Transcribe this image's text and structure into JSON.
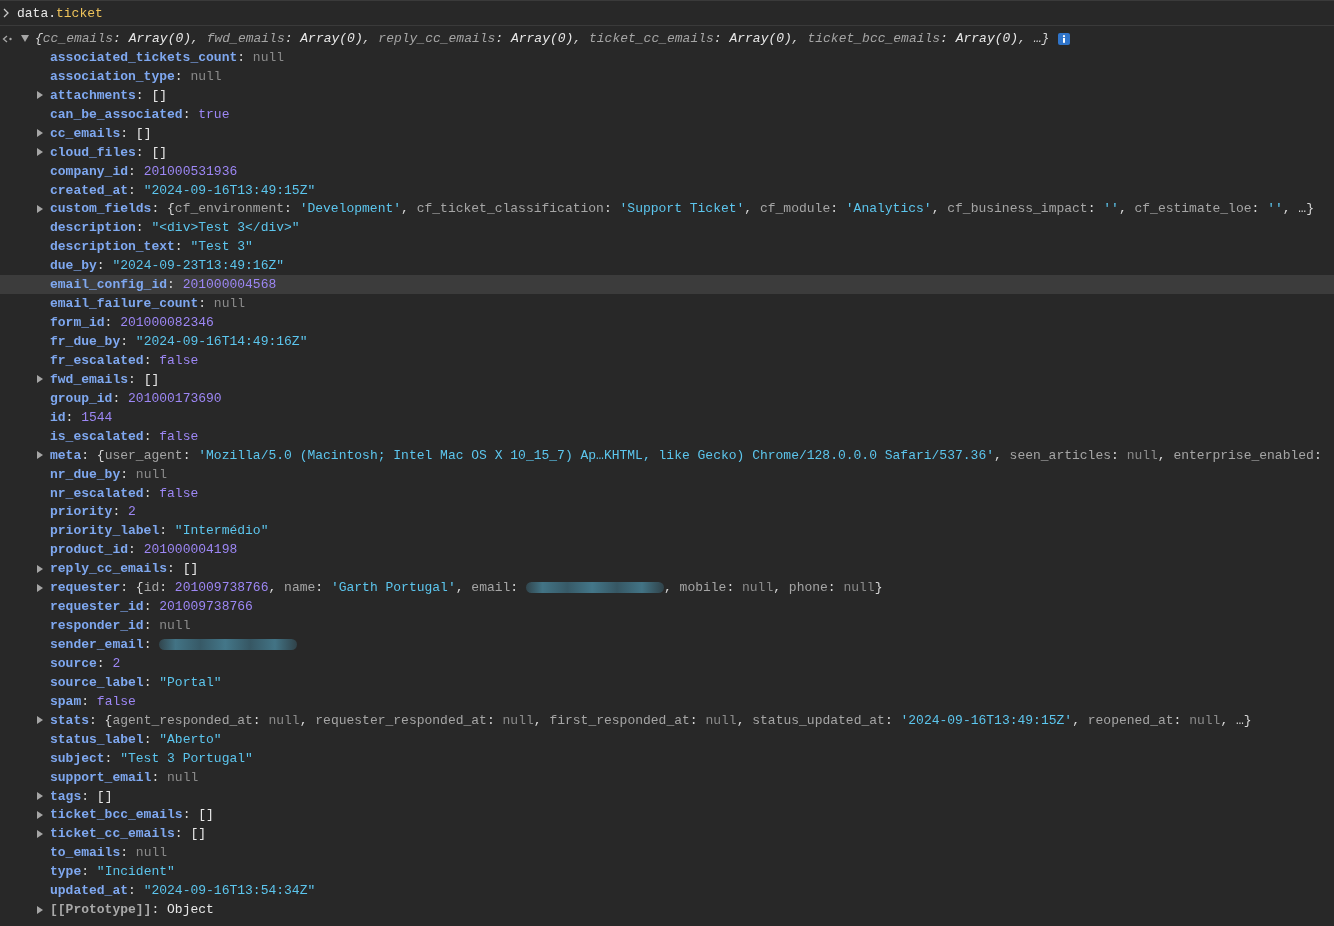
{
  "command": {
    "tokens": [
      {
        "kind": "ident",
        "text": "data."
      },
      {
        "kind": "property",
        "text": "ticket"
      }
    ]
  },
  "result": {
    "expanded": true,
    "tokens": [
      {
        "kind": "punct",
        "text": "{"
      },
      {
        "kind": "plain",
        "text": "cc_emails"
      },
      {
        "kind": "punct",
        "text": ": "
      },
      {
        "kind": "value",
        "text": "Array(0)"
      },
      {
        "kind": "punct",
        "text": ", "
      },
      {
        "kind": "plain",
        "text": "fwd_emails"
      },
      {
        "kind": "punct",
        "text": ": "
      },
      {
        "kind": "value",
        "text": "Array(0)"
      },
      {
        "kind": "punct",
        "text": ", "
      },
      {
        "kind": "plain",
        "text": "reply_cc_emails"
      },
      {
        "kind": "punct",
        "text": ": "
      },
      {
        "kind": "value",
        "text": "Array(0)"
      },
      {
        "kind": "punct",
        "text": ", "
      },
      {
        "kind": "plain",
        "text": "ticket_cc_emails"
      },
      {
        "kind": "punct",
        "text": ": "
      },
      {
        "kind": "value",
        "text": "Array(0)"
      },
      {
        "kind": "punct",
        "text": ", "
      },
      {
        "kind": "plain",
        "text": "ticket_bcc_emails"
      },
      {
        "kind": "punct",
        "text": ": "
      },
      {
        "kind": "value",
        "text": "Array(0)"
      },
      {
        "kind": "punct",
        "text": ", …}"
      }
    ]
  },
  "properties": [
    {
      "selected": false,
      "tokens": [
        {
          "kind": "key",
          "text": "associated_tickets_count"
        },
        {
          "kind": "punct",
          "text": ": "
        },
        {
          "kind": "null",
          "text": "null"
        }
      ]
    },
    {
      "selected": false,
      "tokens": [
        {
          "kind": "key",
          "text": "association_type"
        },
        {
          "kind": "punct",
          "text": ": "
        },
        {
          "kind": "null",
          "text": "null"
        }
      ]
    },
    {
      "expanded": false,
      "selected": false,
      "tokens": [
        {
          "kind": "key",
          "text": "attachments"
        },
        {
          "kind": "punct",
          "text": ": "
        },
        {
          "kind": "value",
          "text": "[]"
        }
      ]
    },
    {
      "selected": false,
      "tokens": [
        {
          "kind": "key",
          "text": "can_be_associated"
        },
        {
          "kind": "punct",
          "text": ": "
        },
        {
          "kind": "boolean",
          "text": "true"
        }
      ]
    },
    {
      "expanded": false,
      "selected": false,
      "tokens": [
        {
          "kind": "key",
          "text": "cc_emails"
        },
        {
          "kind": "punct",
          "text": ": "
        },
        {
          "kind": "value",
          "text": "[]"
        }
      ]
    },
    {
      "expanded": false,
      "selected": false,
      "tokens": [
        {
          "kind": "key",
          "text": "cloud_files"
        },
        {
          "kind": "punct",
          "text": ": "
        },
        {
          "kind": "value",
          "text": "[]"
        }
      ]
    },
    {
      "selected": false,
      "tokens": [
        {
          "kind": "key",
          "text": "company_id"
        },
        {
          "kind": "punct",
          "text": ": "
        },
        {
          "kind": "number",
          "text": "201000531936"
        }
      ]
    },
    {
      "selected": false,
      "tokens": [
        {
          "kind": "key",
          "text": "created_at"
        },
        {
          "kind": "punct",
          "text": ": "
        },
        {
          "kind": "string",
          "text": "\"2024-09-16T13:49:15Z\""
        }
      ]
    },
    {
      "expanded": false,
      "selected": false,
      "tokens": [
        {
          "kind": "key",
          "text": "custom_fields"
        },
        {
          "kind": "punct",
          "text": ": {"
        },
        {
          "kind": "plain",
          "text": "cf_environment"
        },
        {
          "kind": "punct",
          "text": ": "
        },
        {
          "kind": "string",
          "text": "'Development'"
        },
        {
          "kind": "punct",
          "text": ", "
        },
        {
          "kind": "plain",
          "text": "cf_ticket_classification"
        },
        {
          "kind": "punct",
          "text": ": "
        },
        {
          "kind": "string",
          "text": "'Support Ticket'"
        },
        {
          "kind": "punct",
          "text": ", "
        },
        {
          "kind": "plain",
          "text": "cf_module"
        },
        {
          "kind": "punct",
          "text": ": "
        },
        {
          "kind": "string",
          "text": "'Analytics'"
        },
        {
          "kind": "punct",
          "text": ", "
        },
        {
          "kind": "plain",
          "text": "cf_business_impact"
        },
        {
          "kind": "punct",
          "text": ": "
        },
        {
          "kind": "string",
          "text": "''"
        },
        {
          "kind": "punct",
          "text": ", "
        },
        {
          "kind": "plain",
          "text": "cf_estimate_loe"
        },
        {
          "kind": "punct",
          "text": ": "
        },
        {
          "kind": "string",
          "text": "''"
        },
        {
          "kind": "punct",
          "text": ", …}"
        }
      ]
    },
    {
      "selected": false,
      "tokens": [
        {
          "kind": "key",
          "text": "description"
        },
        {
          "kind": "punct",
          "text": ": "
        },
        {
          "kind": "string",
          "text": "\"<div>Test 3</div>\""
        }
      ]
    },
    {
      "selected": false,
      "tokens": [
        {
          "kind": "key",
          "text": "description_text"
        },
        {
          "kind": "punct",
          "text": ": "
        },
        {
          "kind": "string",
          "text": "\"Test 3\""
        }
      ]
    },
    {
      "selected": false,
      "tokens": [
        {
          "kind": "key",
          "text": "due_by"
        },
        {
          "kind": "punct",
          "text": ": "
        },
        {
          "kind": "string",
          "text": "\"2024-09-23T13:49:16Z\""
        }
      ]
    },
    {
      "selected": true,
      "tokens": [
        {
          "kind": "key",
          "text": "email_config_id"
        },
        {
          "kind": "punct",
          "text": ": "
        },
        {
          "kind": "number",
          "text": "201000004568"
        }
      ]
    },
    {
      "selected": false,
      "tokens": [
        {
          "kind": "key",
          "text": "email_failure_count"
        },
        {
          "kind": "punct",
          "text": ": "
        },
        {
          "kind": "null",
          "text": "null"
        }
      ]
    },
    {
      "selected": false,
      "tokens": [
        {
          "kind": "key",
          "text": "form_id"
        },
        {
          "kind": "punct",
          "text": ": "
        },
        {
          "kind": "number",
          "text": "201000082346"
        }
      ]
    },
    {
      "selected": false,
      "tokens": [
        {
          "kind": "key",
          "text": "fr_due_by"
        },
        {
          "kind": "punct",
          "text": ": "
        },
        {
          "kind": "string",
          "text": "\"2024-09-16T14:49:16Z\""
        }
      ]
    },
    {
      "selected": false,
      "tokens": [
        {
          "kind": "key",
          "text": "fr_escalated"
        },
        {
          "kind": "punct",
          "text": ": "
        },
        {
          "kind": "boolean",
          "text": "false"
        }
      ]
    },
    {
      "expanded": false,
      "selected": false,
      "tokens": [
        {
          "kind": "key",
          "text": "fwd_emails"
        },
        {
          "kind": "punct",
          "text": ": "
        },
        {
          "kind": "value",
          "text": "[]"
        }
      ]
    },
    {
      "selected": false,
      "tokens": [
        {
          "kind": "key",
          "text": "group_id"
        },
        {
          "kind": "punct",
          "text": ": "
        },
        {
          "kind": "number",
          "text": "201000173690"
        }
      ]
    },
    {
      "selected": false,
      "tokens": [
        {
          "kind": "key",
          "text": "id"
        },
        {
          "kind": "punct",
          "text": ": "
        },
        {
          "kind": "number",
          "text": "1544"
        }
      ]
    },
    {
      "selected": false,
      "tokens": [
        {
          "kind": "key",
          "text": "is_escalated"
        },
        {
          "kind": "punct",
          "text": ": "
        },
        {
          "kind": "boolean",
          "text": "false"
        }
      ]
    },
    {
      "expanded": false,
      "selected": false,
      "tokens": [
        {
          "kind": "key",
          "text": "meta"
        },
        {
          "kind": "punct",
          "text": ": {"
        },
        {
          "kind": "plain",
          "text": "user_agent"
        },
        {
          "kind": "punct",
          "text": ": "
        },
        {
          "kind": "string",
          "text": "'Mozilla/5.0 (Macintosh; Intel Mac OS X 10_15_7) Ap…KHTML, like Gecko) Chrome/128.0.0.0 Safari/537.36'"
        },
        {
          "kind": "punct",
          "text": ", "
        },
        {
          "kind": "plain",
          "text": "seen_articles"
        },
        {
          "kind": "punct",
          "text": ": "
        },
        {
          "kind": "null",
          "text": "null"
        },
        {
          "kind": "punct",
          "text": ", "
        },
        {
          "kind": "plain",
          "text": "enterprise_enabled"
        },
        {
          "kind": "punct",
          "text": ":"
        }
      ]
    },
    {
      "selected": false,
      "tokens": [
        {
          "kind": "key",
          "text": "nr_due_by"
        },
        {
          "kind": "punct",
          "text": ": "
        },
        {
          "kind": "null",
          "text": "null"
        }
      ]
    },
    {
      "selected": false,
      "tokens": [
        {
          "kind": "key",
          "text": "nr_escalated"
        },
        {
          "kind": "punct",
          "text": ": "
        },
        {
          "kind": "boolean",
          "text": "false"
        }
      ]
    },
    {
      "selected": false,
      "tokens": [
        {
          "kind": "key",
          "text": "priority"
        },
        {
          "kind": "punct",
          "text": ": "
        },
        {
          "kind": "number",
          "text": "2"
        }
      ]
    },
    {
      "selected": false,
      "tokens": [
        {
          "kind": "key",
          "text": "priority_label"
        },
        {
          "kind": "punct",
          "text": ": "
        },
        {
          "kind": "string",
          "text": "\"Intermédio\""
        }
      ]
    },
    {
      "selected": false,
      "tokens": [
        {
          "kind": "key",
          "text": "product_id"
        },
        {
          "kind": "punct",
          "text": ": "
        },
        {
          "kind": "number",
          "text": "201000004198"
        }
      ]
    },
    {
      "expanded": false,
      "selected": false,
      "tokens": [
        {
          "kind": "key",
          "text": "reply_cc_emails"
        },
        {
          "kind": "punct",
          "text": ": "
        },
        {
          "kind": "value",
          "text": "[]"
        }
      ]
    },
    {
      "expanded": false,
      "selected": false,
      "tokens": [
        {
          "kind": "key",
          "text": "requester"
        },
        {
          "kind": "punct",
          "text": ": {"
        },
        {
          "kind": "plain",
          "text": "id"
        },
        {
          "kind": "punct",
          "text": ": "
        },
        {
          "kind": "number",
          "text": "201009738766"
        },
        {
          "kind": "punct",
          "text": ", "
        },
        {
          "kind": "plain",
          "text": "name"
        },
        {
          "kind": "punct",
          "text": ": "
        },
        {
          "kind": "string",
          "text": "'Garth Portugal'"
        },
        {
          "kind": "punct",
          "text": ", "
        },
        {
          "kind": "plain",
          "text": "email"
        },
        {
          "kind": "punct",
          "text": ": "
        },
        {
          "kind": "redacted"
        },
        {
          "kind": "punct",
          "text": ", "
        },
        {
          "kind": "plain",
          "text": "mobile"
        },
        {
          "kind": "punct",
          "text": ": "
        },
        {
          "kind": "null",
          "text": "null"
        },
        {
          "kind": "punct",
          "text": ", "
        },
        {
          "kind": "plain",
          "text": "phone"
        },
        {
          "kind": "punct",
          "text": ": "
        },
        {
          "kind": "null",
          "text": "null"
        },
        {
          "kind": "punct",
          "text": "}"
        }
      ]
    },
    {
      "selected": false,
      "tokens": [
        {
          "kind": "key",
          "text": "requester_id"
        },
        {
          "kind": "punct",
          "text": ": "
        },
        {
          "kind": "number",
          "text": "201009738766"
        }
      ]
    },
    {
      "selected": false,
      "tokens": [
        {
          "kind": "key",
          "text": "responder_id"
        },
        {
          "kind": "punct",
          "text": ": "
        },
        {
          "kind": "null",
          "text": "null"
        }
      ]
    },
    {
      "selected": false,
      "tokens": [
        {
          "kind": "key",
          "text": "sender_email"
        },
        {
          "kind": "punct",
          "text": ": "
        },
        {
          "kind": "redacted"
        }
      ]
    },
    {
      "selected": false,
      "tokens": [
        {
          "kind": "key",
          "text": "source"
        },
        {
          "kind": "punct",
          "text": ": "
        },
        {
          "kind": "number",
          "text": "2"
        }
      ]
    },
    {
      "selected": false,
      "tokens": [
        {
          "kind": "key",
          "text": "source_label"
        },
        {
          "kind": "punct",
          "text": ": "
        },
        {
          "kind": "string",
          "text": "\"Portal\""
        }
      ]
    },
    {
      "selected": false,
      "tokens": [
        {
          "kind": "key",
          "text": "spam"
        },
        {
          "kind": "punct",
          "text": ": "
        },
        {
          "kind": "boolean",
          "text": "false"
        }
      ]
    },
    {
      "expanded": false,
      "selected": false,
      "tokens": [
        {
          "kind": "key",
          "text": "stats"
        },
        {
          "kind": "punct",
          "text": ": {"
        },
        {
          "kind": "plain",
          "text": "agent_responded_at"
        },
        {
          "kind": "punct",
          "text": ": "
        },
        {
          "kind": "null",
          "text": "null"
        },
        {
          "kind": "punct",
          "text": ", "
        },
        {
          "kind": "plain",
          "text": "requester_responded_at"
        },
        {
          "kind": "punct",
          "text": ": "
        },
        {
          "kind": "null",
          "text": "null"
        },
        {
          "kind": "punct",
          "text": ", "
        },
        {
          "kind": "plain",
          "text": "first_responded_at"
        },
        {
          "kind": "punct",
          "text": ": "
        },
        {
          "kind": "null",
          "text": "null"
        },
        {
          "kind": "punct",
          "text": ", "
        },
        {
          "kind": "plain",
          "text": "status_updated_at"
        },
        {
          "kind": "punct",
          "text": ": "
        },
        {
          "kind": "string",
          "text": "'2024-09-16T13:49:15Z'"
        },
        {
          "kind": "punct",
          "text": ", "
        },
        {
          "kind": "plain",
          "text": "reopened_at"
        },
        {
          "kind": "punct",
          "text": ": "
        },
        {
          "kind": "null",
          "text": "null"
        },
        {
          "kind": "punct",
          "text": ", …}"
        }
      ]
    },
    {
      "selected": false,
      "tokens": [
        {
          "kind": "key",
          "text": "status_label"
        },
        {
          "kind": "punct",
          "text": ": "
        },
        {
          "kind": "string",
          "text": "\"Aberto\""
        }
      ]
    },
    {
      "selected": false,
      "tokens": [
        {
          "kind": "key",
          "text": "subject"
        },
        {
          "kind": "punct",
          "text": ": "
        },
        {
          "kind": "string",
          "text": "\"Test 3 Portugal\""
        }
      ]
    },
    {
      "selected": false,
      "tokens": [
        {
          "kind": "key",
          "text": "support_email"
        },
        {
          "kind": "punct",
          "text": ": "
        },
        {
          "kind": "null",
          "text": "null"
        }
      ]
    },
    {
      "expanded": false,
      "selected": false,
      "tokens": [
        {
          "kind": "key",
          "text": "tags"
        },
        {
          "kind": "punct",
          "text": ": "
        },
        {
          "kind": "value",
          "text": "[]"
        }
      ]
    },
    {
      "expanded": false,
      "selected": false,
      "tokens": [
        {
          "kind": "key",
          "text": "ticket_bcc_emails"
        },
        {
          "kind": "punct",
          "text": ": "
        },
        {
          "kind": "value",
          "text": "[]"
        }
      ]
    },
    {
      "expanded": false,
      "selected": false,
      "tokens": [
        {
          "kind": "key",
          "text": "ticket_cc_emails"
        },
        {
          "kind": "punct",
          "text": ": "
        },
        {
          "kind": "value",
          "text": "[]"
        }
      ]
    },
    {
      "selected": false,
      "tokens": [
        {
          "kind": "key",
          "text": "to_emails"
        },
        {
          "kind": "punct",
          "text": ": "
        },
        {
          "kind": "null",
          "text": "null"
        }
      ]
    },
    {
      "selected": false,
      "tokens": [
        {
          "kind": "key",
          "text": "type"
        },
        {
          "kind": "punct",
          "text": ": "
        },
        {
          "kind": "string",
          "text": "\"Incident\""
        }
      ]
    },
    {
      "selected": false,
      "tokens": [
        {
          "kind": "key",
          "text": "updated_at"
        },
        {
          "kind": "punct",
          "text": ": "
        },
        {
          "kind": "string",
          "text": "\"2024-09-16T13:54:34Z\""
        }
      ]
    },
    {
      "expanded": false,
      "selected": false,
      "tokens": [
        {
          "kind": "internal",
          "text": "[[Prototype]]"
        },
        {
          "kind": "punct",
          "text": ": "
        },
        {
          "kind": "value",
          "text": "Object"
        }
      ]
    }
  ]
}
